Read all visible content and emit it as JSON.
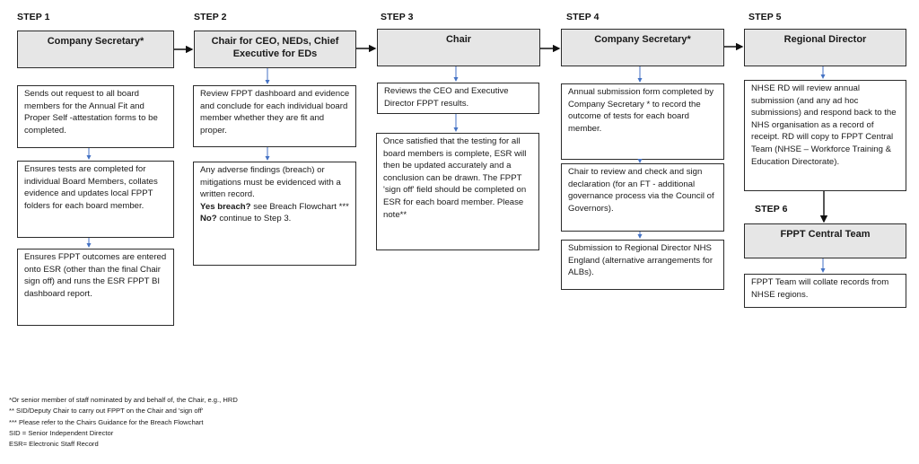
{
  "steps": [
    {
      "label": "STEP 1",
      "header": "Company Secretary*",
      "boxes": [
        "Sends out request to all board members for the Annual Fit and Proper Self -attestation forms to be completed.",
        "Ensures tests are completed for individual Board Members, collates evidence and updates local FPPT folders for each board member.",
        "Ensures FPPT outcomes are entered onto ESR (other than the final Chair sign off) and runs the ESR FPPT BI dashboard report."
      ]
    },
    {
      "label": "STEP 2",
      "header": "Chair for CEO, NEDs, Chief Executive for EDs",
      "boxes": [
        "Review FPPT dashboard and evidence and conclude for each individual board member whether they are fit and proper."
      ],
      "breach_box": {
        "intro": "Any adverse findings (breach) or mitigations must be evidenced with a written record.",
        "yes_label": "Yes breach?",
        "yes_text": " see Breach Flowchart ***",
        "no_label": "No?",
        "no_text": " continue to Step 3."
      }
    },
    {
      "label": "STEP 3",
      "header": "Chair",
      "boxes": [
        "Reviews the  CEO and Executive Director FPPT results.",
        "Once satisfied that the testing for all board members is complete, ESR will then be updated accurately  and a conclusion can be drawn. The FPPT 'sign off' field should be completed on ESR for each board member. Please note**"
      ]
    },
    {
      "label": "STEP 4",
      "header": "Company Secretary*",
      "boxes": [
        "Annual submission form completed by Company Secretary * to record the outcome of tests for each board member.",
        "Chair to review and check and sign declaration (for an FT - additional governance process via the Council of Governors).",
        "Submission to Regional Director NHS England (alternative arrangements for ALBs)."
      ]
    },
    {
      "label": "STEP 5",
      "header": "Regional Director",
      "boxes": [
        "NHSE RD will review annual submission (and any ad hoc submissions) and respond back to the NHS organisation as a record of receipt. RD will copy to FPPT Central Team (NHSE   – Workforce Training & Education Directorate)."
      ]
    },
    {
      "label": "STEP 6",
      "header": "FPPT Central Team",
      "boxes": [
        "FPPT Team will collate records from NHSE regions."
      ]
    }
  ],
  "footnotes": [
    "*Or senior member of staff nominated by and behalf of, the Chair, e.g., HRD",
    "** SID/Deputy Chair to carry out FPPT on the Chair and 'sign off'",
    "*** Please refer to the Chairs Guidance for the Breach Flowchart",
    "SID = Senior Independent Director",
    "ESR= Electronic Staff Record"
  ],
  "colors": {
    "header_fill": "#e6e6e6",
    "border": "#2b2b2b",
    "arrow_blue": "#4472c4",
    "arrow_black": "#111111"
  }
}
